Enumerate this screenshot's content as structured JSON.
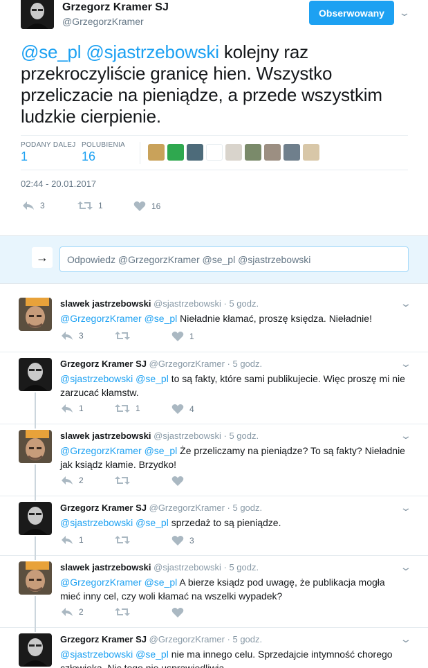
{
  "header": {
    "name": "Grzegorz Kramer SJ",
    "handle": "@GrzegorzKramer",
    "follow_label": "Obserwowany"
  },
  "tweet": {
    "mention1": "@se_pl",
    "mention2": "@sjastrzebowski",
    "text": "kolejny raz przekroczyliście granicę hien. Wszystko przeliczacie na pieniądze, a przede wszystkim ludzkie cierpienie.",
    "retweets_label": "PODANY DALEJ",
    "retweets_value": "1",
    "likes_label": "POLUBIENIA",
    "likes_value": "16",
    "timestamp": "02:44 - 20.01.2017",
    "actions": {
      "reply_count": "3",
      "retweet_count": "1",
      "like_count": "16"
    },
    "liker_colors": [
      "#c9a25a",
      "#2fa84f",
      "#4d6b7a",
      "#ffffff",
      "#d9d4cc",
      "#7a8a6a",
      "#9c8f82",
      "#6f7f8c",
      "#d8c7a8"
    ]
  },
  "reply_box": {
    "placeholder": "Odpowiedz @GrzegorzKramer @se_pl @sjastrzebowski",
    "arrow": "→"
  },
  "replies": [
    {
      "name": "slawek jastrzebowski",
      "handle": "@sjastrzebowski",
      "time": "· 5 godz.",
      "mentions": "@GrzegorzKramer @se_pl",
      "text": "Nieładnie kłamać, proszę księdza. Nieładnie!",
      "reply_count": "3",
      "retweet_count": "",
      "like_count": "1"
    },
    {
      "name": "Grzegorz Kramer SJ",
      "handle": "@GrzegorzKramer",
      "time": "· 5 godz.",
      "mentions": "@sjastrzebowski @se_pl",
      "text": "to są fakty, które sami publikujecie. Więc proszę mi nie zarzucać kłamstw.",
      "reply_count": "1",
      "retweet_count": "1",
      "like_count": "4"
    },
    {
      "name": "slawek jastrzebowski",
      "handle": "@sjastrzebowski",
      "time": "· 5 godz.",
      "mentions": "@GrzegorzKramer @se_pl",
      "text": "Że przeliczamy na pieniądze? To są fakty? Nieładnie jak ksiądz kłamie. Brzydko!",
      "reply_count": "2",
      "retweet_count": "",
      "like_count": ""
    },
    {
      "name": "Grzegorz Kramer SJ",
      "handle": "@GrzegorzKramer",
      "time": "· 5 godz.",
      "mentions": "@sjastrzebowski @se_pl",
      "text": "sprzedaż to są pieniądze.",
      "reply_count": "1",
      "retweet_count": "",
      "like_count": "3"
    },
    {
      "name": "slawek jastrzebowski",
      "handle": "@sjastrzebowski",
      "time": "· 5 godz.",
      "mentions": "@GrzegorzKramer @se_pl",
      "text": "A bierze ksiądz pod uwagę, że publikacja mogła mieć inny cel, czy woli kłamać na wszelki wypadek?",
      "reply_count": "2",
      "retweet_count": "",
      "like_count": ""
    },
    {
      "name": "Grzegorz Kramer SJ",
      "handle": "@GrzegorzKramer",
      "time": "· 5 godz.",
      "mentions": "@sjastrzebowski @se_pl",
      "text": "nie ma innego celu. Sprzedajcie intymność chorego człowieka. Nic tego nie usprawiedliwia.",
      "reply_count": "",
      "retweet_count": "",
      "like_count": ""
    }
  ]
}
